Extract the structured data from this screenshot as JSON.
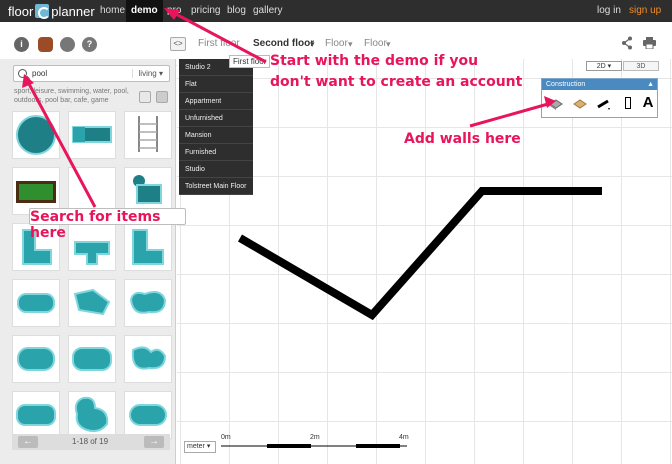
{
  "nav": {
    "logo_left": "floor",
    "logo_right": "planner",
    "items": [
      "home",
      "demo",
      "pro",
      "pricing",
      "blog",
      "gallery"
    ],
    "login": "log in",
    "signup": "sign up"
  },
  "toolbar": {
    "toggle": "<>",
    "floors": [
      "First floor",
      "Second floor",
      "Floor",
      "Floor"
    ],
    "tooltip": "First floor"
  },
  "search": {
    "query": "pool",
    "category": "living",
    "tags": "sport, leisure, swimming, water, pool, outdoors, pool bar, cafe, game"
  },
  "pager": {
    "prev": "←",
    "next": "→",
    "count": "1-18 of 19"
  },
  "dropdown": {
    "items": [
      "Studio 2",
      "Flat",
      "Appartment",
      "Unfurnished",
      "Mansion",
      "Furnished",
      "Studio",
      "Tolstreet Main Floor"
    ]
  },
  "view": {
    "mode_2d": "2D",
    "mode_3d": "3D"
  },
  "construction": {
    "title": "Construction",
    "text_tool": "A"
  },
  "scale": {
    "unit": "meter",
    "marks": [
      "0m",
      "2m",
      "4m"
    ]
  },
  "annotations": {
    "demo_line1": "Start with the demo if you",
    "demo_line2": "don't want to create an account",
    "walls": "Add walls here",
    "search": "Search for items here"
  },
  "colors": {
    "annotation": "#e8155a",
    "pool": "#3aa9b3",
    "nav_bg": "#2e2e2e"
  }
}
